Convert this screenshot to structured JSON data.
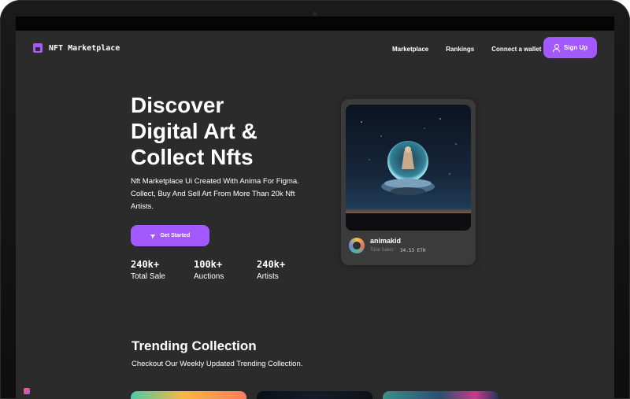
{
  "nav": {
    "logo_text": "NFT Marketplace",
    "links": [
      "Marketplace",
      "Rankings",
      "Connect a wallet"
    ],
    "signup_label": "Sign Up"
  },
  "hero": {
    "title_lines": [
      "Discover",
      "Digital Art &",
      "Collect Nfts"
    ],
    "description": "Nft Marketplace Ui Created With Anima For Figma. Collect, Buy And Sell Art From More Than 20k Nft Artists.",
    "cta_label": "Get Started",
    "stats": [
      {
        "value": "240k+",
        "label": "Total Sale"
      },
      {
        "value": "100k+",
        "label": "Auctions"
      },
      {
        "value": "240k+",
        "label": "Artists"
      }
    ]
  },
  "card": {
    "artist": "animakid",
    "sales_label": "Total Sales:",
    "sales_value": "34.53 ETH"
  },
  "trending": {
    "title": "Trending Collection",
    "subtitle": "Checkout Our Weekly Updated Trending Collection."
  },
  "icons": {
    "logo": "storefront-icon",
    "signup": "user-icon",
    "cta": "rocket-icon"
  },
  "colors": {
    "accent": "#a259ff",
    "page_background": "#2b2b2b",
    "card_background": "#3b3b3b",
    "muted_text": "#858584"
  }
}
